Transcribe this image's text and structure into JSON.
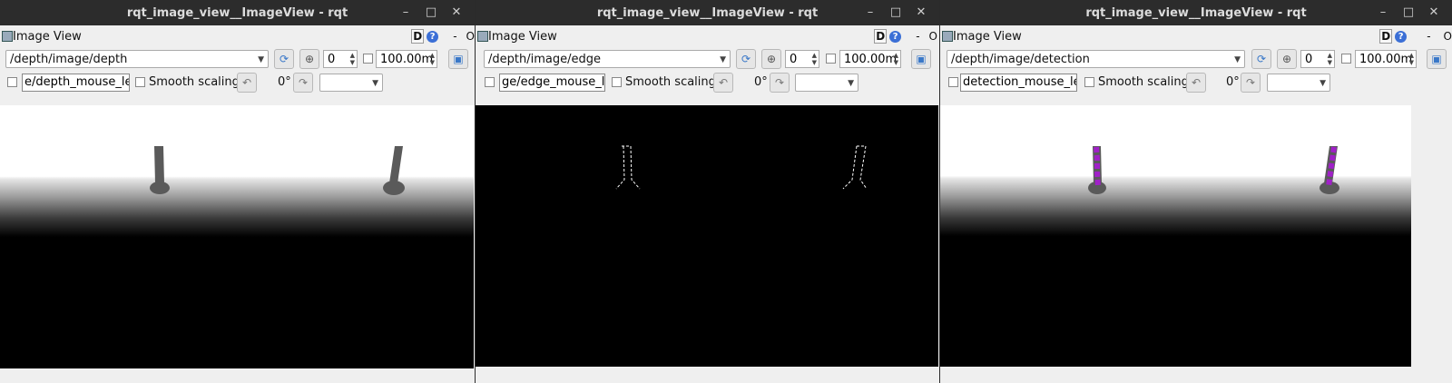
{
  "windows": [
    {
      "title": "rqt_image_view__ImageView - rqt",
      "plugin": "Image View",
      "d_label": "D",
      "q_label": "?",
      "dash": "-",
      "o_label": "O",
      "topic": "/depth/image/depth",
      "spin_value": "0",
      "zoom_value": "100.00m",
      "mouse_topic": "e/depth_mouse_left",
      "smooth_label": "Smooth scaling",
      "rotation": "0°",
      "image": "depth-gradient"
    },
    {
      "title": "rqt_image_view__ImageView - rqt",
      "plugin": "Image View",
      "d_label": "D",
      "q_label": "?",
      "dash": "-",
      "o_label": "O",
      "topic": "/depth/image/edge",
      "spin_value": "0",
      "zoom_value": "100.00m",
      "mouse_topic": "ge/edge_mouse_left",
      "smooth_label": "Smooth scaling",
      "rotation": "0°",
      "image": "edge-outline"
    },
    {
      "title": "rqt_image_view__ImageView - rqt",
      "plugin": "Image View",
      "d_label": "D",
      "q_label": "?",
      "dash": "-",
      "o_label": "O",
      "topic": "/depth/image/detection",
      "spin_value": "0",
      "zoom_value": "100.00m",
      "mouse_topic": "detection_mouse_left",
      "smooth_label": "Smooth scaling",
      "rotation": "0°",
      "image": "detection-overlay"
    }
  ],
  "controls": {
    "minimize": "–",
    "maximize": "□",
    "close": "✕"
  },
  "colors": {
    "titlebar": "#2c2c2c",
    "detection": "#a020c8",
    "pole": "#5a5a5a"
  }
}
